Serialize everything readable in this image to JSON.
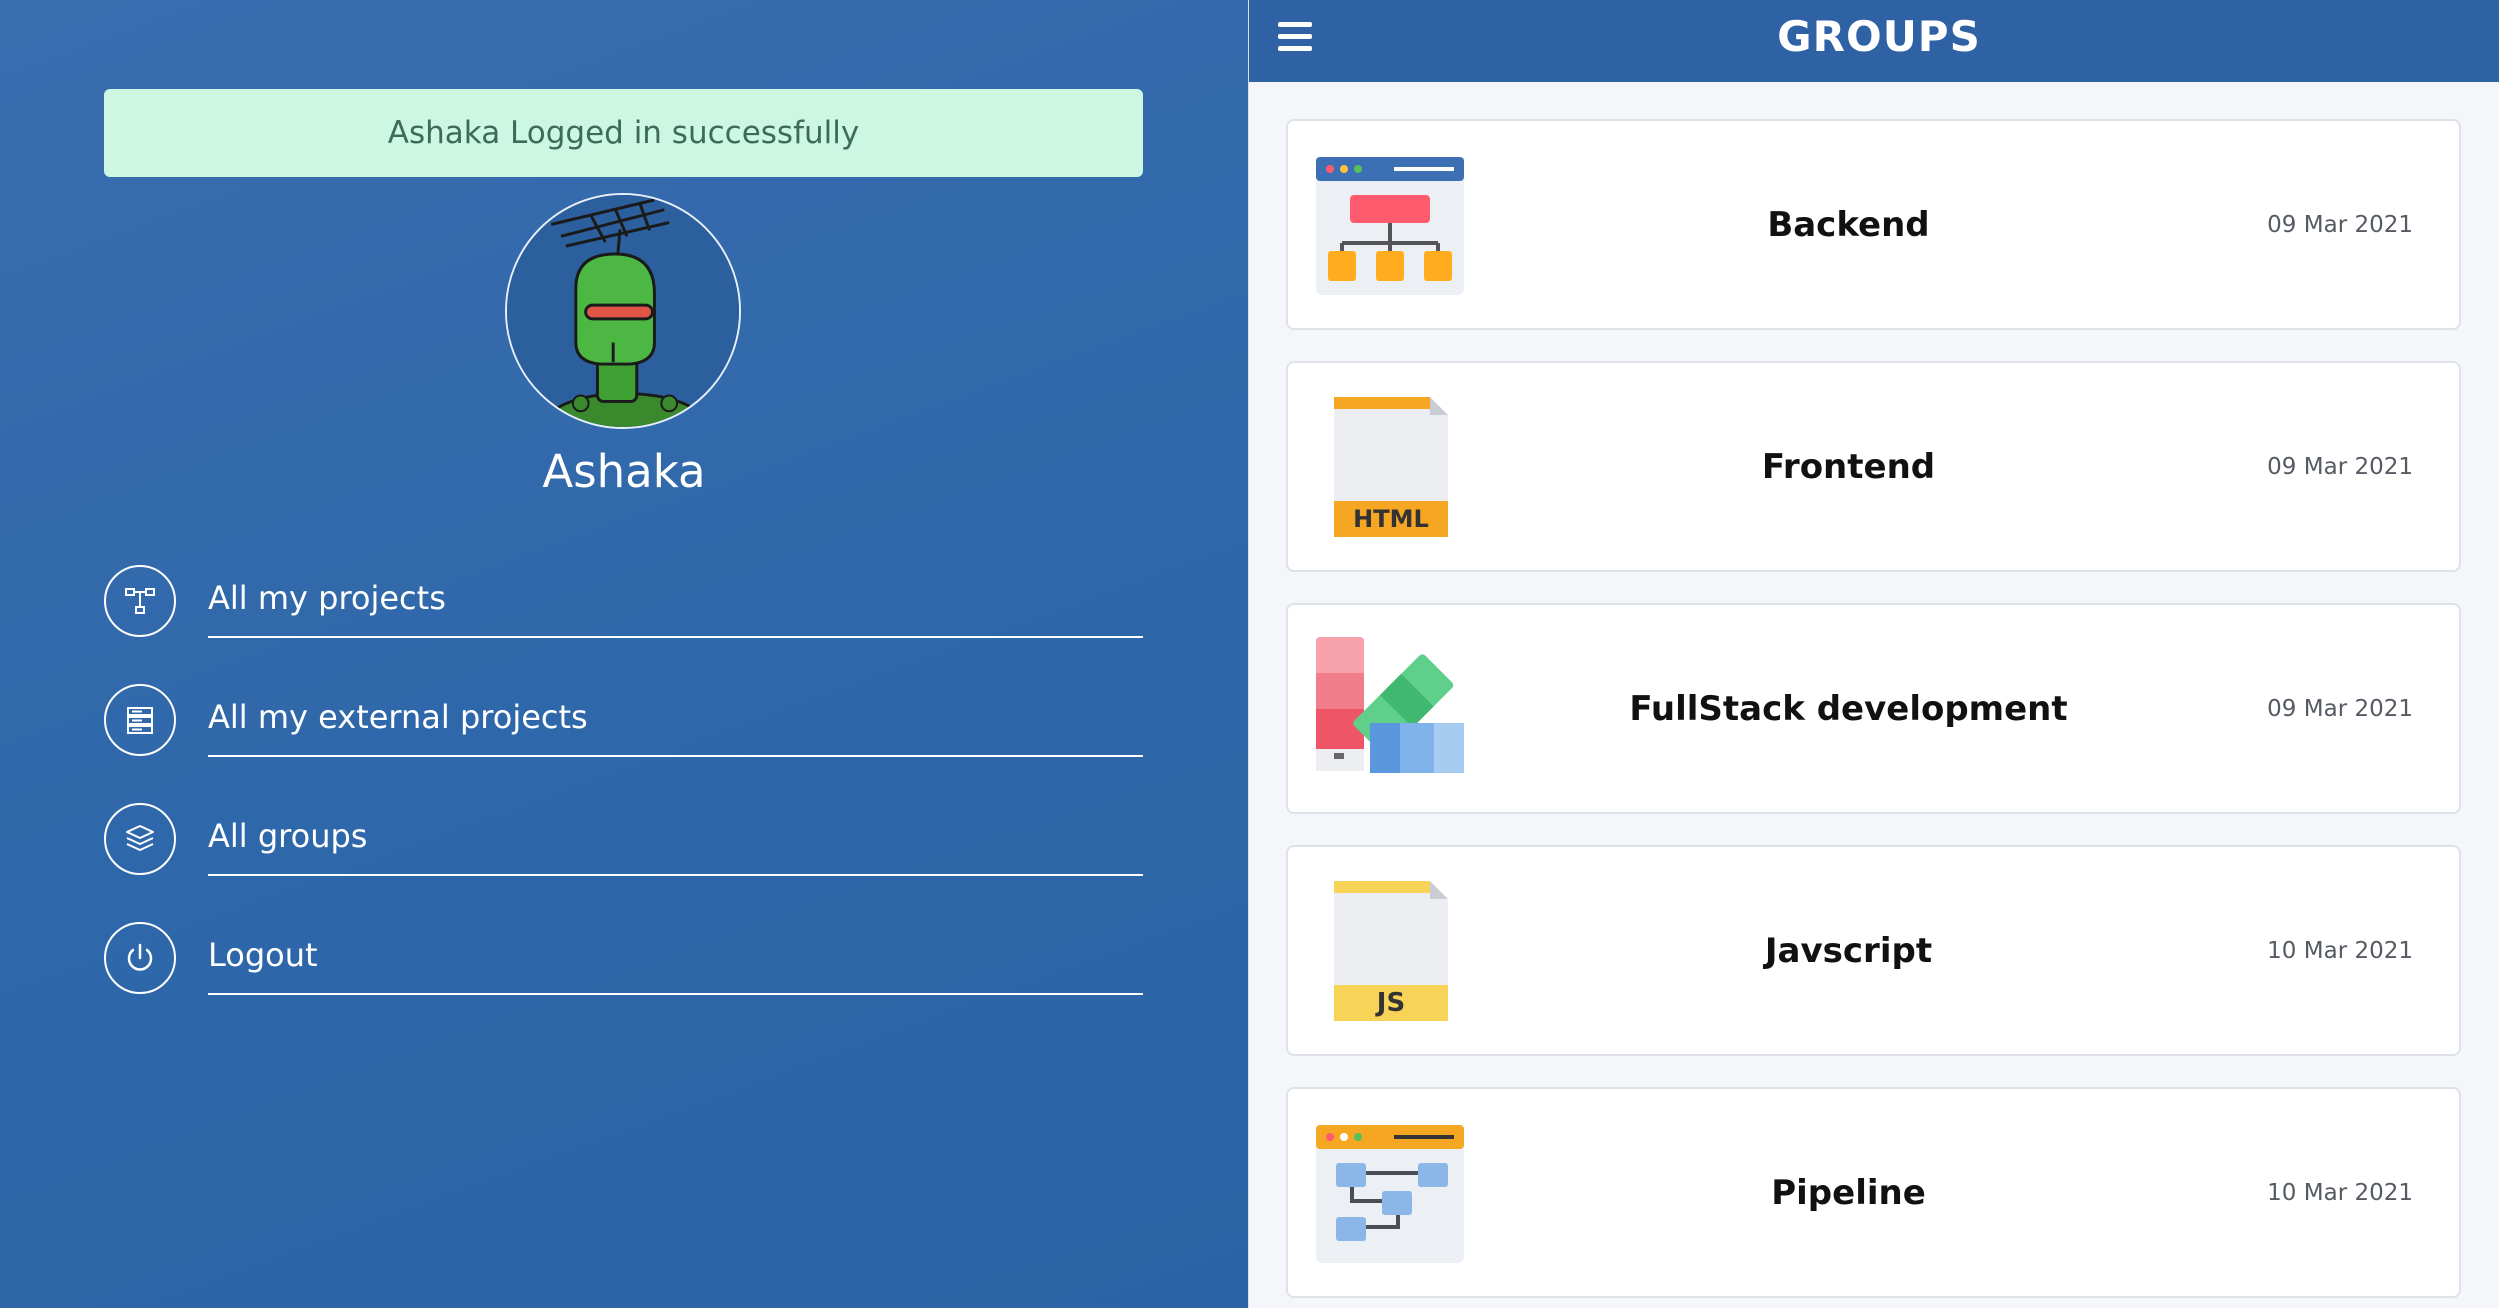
{
  "toast": {
    "message": "Ashaka Logged in successfully"
  },
  "profile": {
    "name": "Ashaka",
    "avatar_icon": "robot-avatar-icon"
  },
  "menu": {
    "items": [
      {
        "label": "All my projects",
        "icon": "hierarchy-icon"
      },
      {
        "label": "All my external projects",
        "icon": "server-list-icon"
      },
      {
        "label": "All groups",
        "icon": "layers-icon"
      },
      {
        "label": "Logout",
        "icon": "power-icon"
      }
    ]
  },
  "header": {
    "title": "GROUPS",
    "menu_icon": "hamburger-icon"
  },
  "groups": [
    {
      "name": "Backend",
      "date": "09 Mar 2021",
      "icon": "sitemap-window-icon"
    },
    {
      "name": "Frontend",
      "date": "09 Mar 2021",
      "icon": "html-file-icon",
      "icon_text": "HTML"
    },
    {
      "name": "FullStack development",
      "date": "09 Mar 2021",
      "icon": "palette-swatches-icon"
    },
    {
      "name": "Javscript",
      "date": "10 Mar 2021",
      "icon": "js-file-icon",
      "icon_text": "JS"
    },
    {
      "name": "Pipeline",
      "date": "10 Mar 2021",
      "icon": "pipeline-window-icon"
    }
  ],
  "colors": {
    "sidebar_bg": "#2f68aa",
    "topbar_bg": "#2f62a4",
    "toast_bg": "#cdf7e3",
    "main_bg": "#f4f6f9"
  }
}
